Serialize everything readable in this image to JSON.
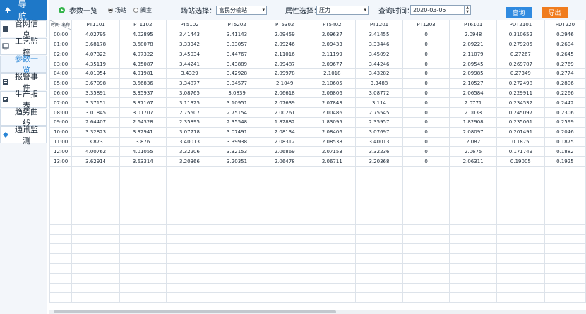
{
  "sidebar": {
    "header": "导 航",
    "items": [
      {
        "label": "管网信息",
        "icon": "pipe-icon"
      },
      {
        "label": "工艺监控",
        "icon": "monitor-icon"
      },
      {
        "label": "参数一览",
        "icon": "list-icon"
      },
      {
        "label": "报警事件",
        "icon": "alarm-icon"
      },
      {
        "label": "生产报表",
        "icon": "report-icon"
      },
      {
        "label": "趋势曲线",
        "icon": "trend-icon"
      },
      {
        "label": "通讯监测",
        "icon": "signal-icon"
      }
    ],
    "active_index": 2
  },
  "toolbar": {
    "page_title": "参数一览",
    "radio_station": "场站",
    "radio_valve": "阀室",
    "station_label": "场站选择：",
    "station_value": "富民分输站",
    "attribute_label": "属性选择：",
    "attribute_value": "压力",
    "query_time_label": "查询时间：",
    "query_time_value": "2020-03-05",
    "query_button": "查询",
    "export_button": "导出"
  },
  "colors": {
    "accent": "#1e78c8",
    "query_button": "#2f8ae0",
    "export_button": "#f07c1e",
    "active_nav": "#2a86d6"
  },
  "table": {
    "corner_time": "时间",
    "corner_name": "名称",
    "columns": [
      "PT1101",
      "PT1102",
      "PT5102",
      "PT5202",
      "PT5302",
      "PT5402",
      "PT1201",
      "PT1203",
      "PT6101",
      "PDT2101",
      "PDT220"
    ],
    "rows": [
      {
        "time": "00:00",
        "values": [
          "4.02795",
          "4.02895",
          "3.41443",
          "3.41143",
          "2.09459",
          "2.09637",
          "3.41455",
          "0",
          "2.0948",
          "0.310652",
          "0.2946"
        ]
      },
      {
        "time": "01:00",
        "values": [
          "3.68178",
          "3.68078",
          "3.33342",
          "3.33057",
          "2.09246",
          "2.09433",
          "3.33446",
          "0",
          "2.09221",
          "0.279205",
          "0.2604"
        ]
      },
      {
        "time": "02:00",
        "values": [
          "4.07322",
          "4.07322",
          "3.45034",
          "3.44767",
          "2.11016",
          "2.11199",
          "3.45092",
          "0",
          "2.11079",
          "0.27267",
          "0.2645"
        ]
      },
      {
        "time": "03:00",
        "values": [
          "4.35119",
          "4.35087",
          "3.44241",
          "3.43889",
          "2.09487",
          "2.09677",
          "3.44246",
          "0",
          "2.09545",
          "0.269707",
          "0.2769"
        ]
      },
      {
        "time": "04:00",
        "values": [
          "4.01954",
          "4.01981",
          "3.4329",
          "3.42928",
          "2.09978",
          "2.1018",
          "3.43282",
          "0",
          "2.09985",
          "0.27349",
          "0.2774"
        ]
      },
      {
        "time": "05:00",
        "values": [
          "3.67098",
          "3.66836",
          "3.34877",
          "3.34577",
          "2.1049",
          "2.10605",
          "3.3488",
          "0",
          "2.10527",
          "0.272498",
          "0.2806"
        ]
      },
      {
        "time": "06:00",
        "values": [
          "3.35891",
          "3.35937",
          "3.08765",
          "3.0839",
          "2.06618",
          "2.06806",
          "3.08772",
          "0",
          "2.06584",
          "0.229911",
          "0.2266"
        ]
      },
      {
        "time": "07:00",
        "values": [
          "3.37151",
          "3.37167",
          "3.11325",
          "3.10951",
          "2.07639",
          "2.07843",
          "3.114",
          "0",
          "2.0771",
          "0.234532",
          "0.2442"
        ]
      },
      {
        "time": "08:00",
        "values": [
          "3.01845",
          "3.01707",
          "2.75507",
          "2.75154",
          "2.00261",
          "2.00486",
          "2.75545",
          "0",
          "2.0033",
          "0.245097",
          "0.2306"
        ]
      },
      {
        "time": "09:00",
        "values": [
          "2.64407",
          "2.64328",
          "2.35895",
          "2.35548",
          "1.82882",
          "1.83095",
          "2.35957",
          "0",
          "1.82908",
          "0.235061",
          "0.2599"
        ]
      },
      {
        "time": "10:00",
        "values": [
          "3.32823",
          "3.32941",
          "3.07718",
          "3.07491",
          "2.08134",
          "2.08406",
          "3.07697",
          "0",
          "2.08097",
          "0.201491",
          "0.2046"
        ]
      },
      {
        "time": "11:00",
        "values": [
          "3.873",
          "3.876",
          "3.40013",
          "3.39938",
          "2.08312",
          "2.08538",
          "3.40013",
          "0",
          "2.082",
          "0.1875",
          "0.1875"
        ]
      },
      {
        "time": "12:00",
        "values": [
          "4.00762",
          "4.01055",
          "3.32206",
          "3.32153",
          "2.06869",
          "2.07153",
          "3.32236",
          "0",
          "2.0675",
          "0.171749",
          "0.1882"
        ]
      },
      {
        "time": "13:00",
        "values": [
          "3.62914",
          "3.63314",
          "3.20366",
          "3.20351",
          "2.06478",
          "2.06711",
          "3.20368",
          "0",
          "2.06311",
          "0.19005",
          "0.1925"
        ]
      }
    ],
    "empty_rows": 14
  }
}
